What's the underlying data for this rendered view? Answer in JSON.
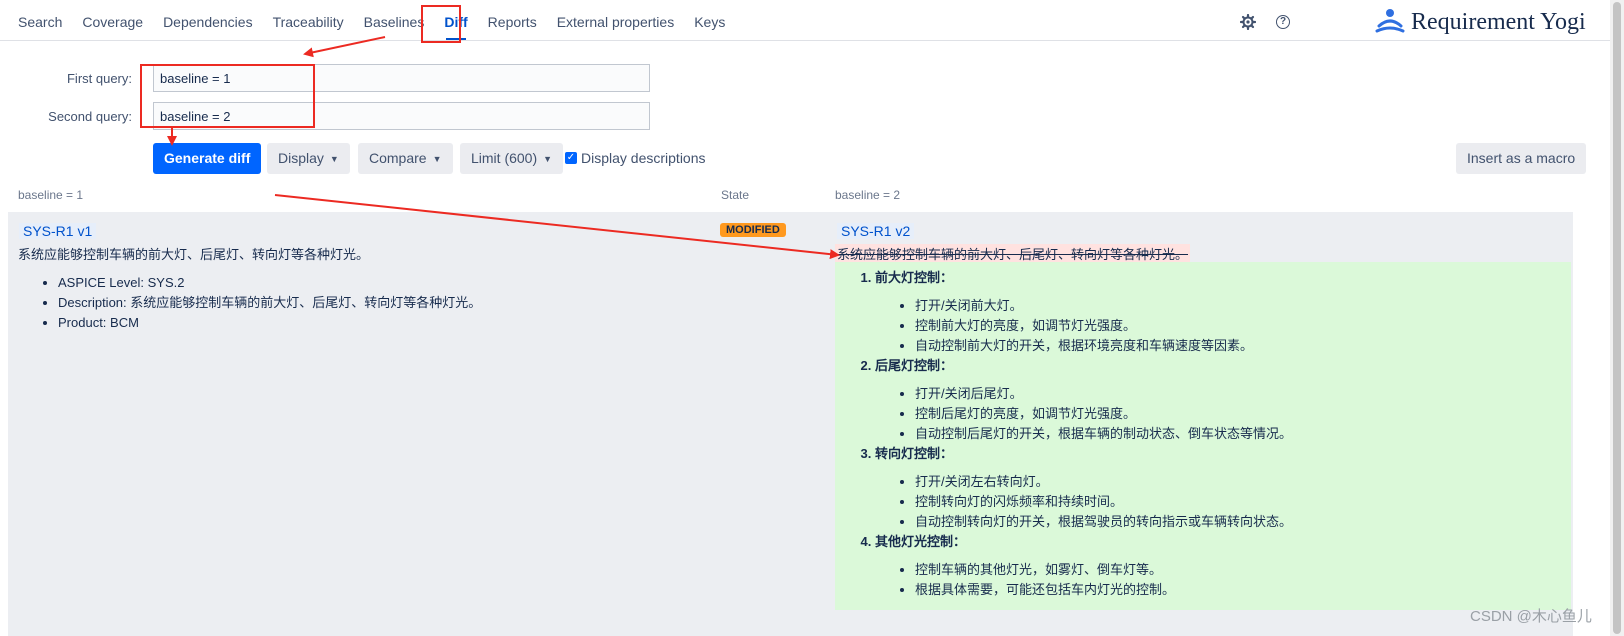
{
  "nav": {
    "items": [
      "Search",
      "Coverage",
      "Dependencies",
      "Traceability",
      "Baselines",
      "Diff",
      "Reports",
      "External properties",
      "Keys"
    ],
    "active": "Diff"
  },
  "brand": {
    "name": "Requirement Yogi"
  },
  "icons": {
    "settings": "gear-icon",
    "help": "help-icon",
    "logo": "yogi-logo-icon",
    "help_glyph": "?"
  },
  "form": {
    "first_query_label": "First query:",
    "first_query_value": "baseline = 1",
    "second_query_label": "Second query:",
    "second_query_value": "baseline = 2"
  },
  "toolbar": {
    "generate_label": "Generate diff",
    "display_label": "Display",
    "compare_label": "Compare",
    "limit_label": "Limit (600)",
    "display_descriptions_label": "Display descriptions",
    "display_descriptions_checked": true,
    "insert_macro_label": "Insert as a macro"
  },
  "columns": {
    "left": "baseline = 1",
    "state": "State",
    "right": "baseline = 2"
  },
  "diff": {
    "left": {
      "key": "SYS-R1 v1",
      "description": "系统应能够控制车辆的前大灯、后尾灯、转向灯等各种灯光。",
      "properties": [
        "ASPICE Level: SYS.2",
        "Description: 系统应能够控制车辆的前大灯、后尾灯、转向灯等各种灯光。",
        "Product: BCM"
      ]
    },
    "state": "MODIFIED",
    "right": {
      "key": "SYS-R1 v2",
      "removed_text": "系统应能够控制车辆的前大灯、后尾灯、转向灯等各种灯光。",
      "sections": [
        {
          "title": "前大灯控制：",
          "items": [
            "打开/关闭前大灯。",
            "控制前大灯的亮度，如调节灯光强度。",
            "自动控制前大灯的开关，根据环境亮度和车辆速度等因素。"
          ]
        },
        {
          "title": "后尾灯控制：",
          "items": [
            "打开/关闭后尾灯。",
            "控制后尾灯的亮度，如调节灯光强度。",
            "自动控制后尾灯的开关，根据车辆的制动状态、倒车状态等情况。"
          ]
        },
        {
          "title": "转向灯控制：",
          "items": [
            "打开/关闭左右转向灯。",
            "控制转向灯的闪烁频率和持续时间。",
            "自动控制转向灯的开关，根据驾驶员的转向指示或车辆转向状态。"
          ]
        },
        {
          "title": "其他灯光控制：",
          "items": [
            "控制车辆的其他灯光，如雾灯、倒车灯等。",
            "根据具体需要，可能还包括车内灯光的控制。"
          ]
        }
      ]
    }
  },
  "colors": {
    "accent": "#0065ff",
    "annotation": "#ec2a22",
    "modified_badge": "#ff991f",
    "removed_bg": "#ffe2e0",
    "added_bg": "#dbf9d9"
  },
  "watermark": "CSDN @木心鱼儿"
}
